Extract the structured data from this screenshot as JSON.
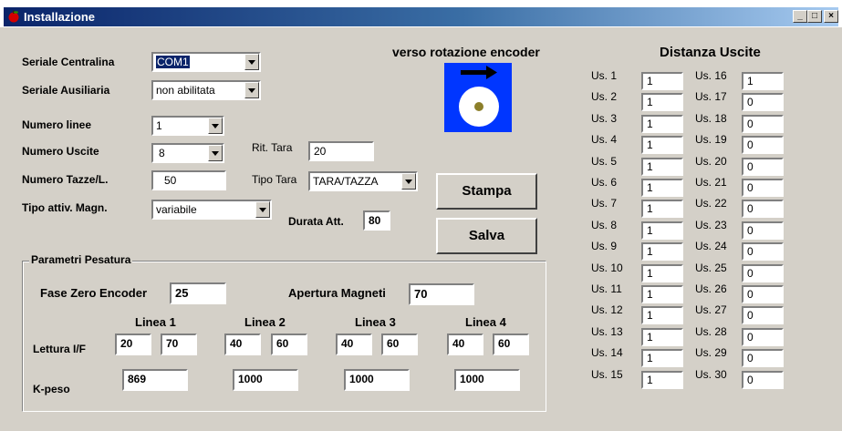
{
  "window": {
    "title": "Installazione",
    "min": "_",
    "max": "□",
    "close": "×"
  },
  "fields": {
    "seriale_centralina": {
      "label": "Seriale Centralina",
      "value": "COM1"
    },
    "seriale_ausiliaria": {
      "label": "Seriale Ausiliaria",
      "value": "non abilitata"
    },
    "numero_linee": {
      "label": "Numero linee",
      "value": "1"
    },
    "numero_uscite": {
      "label": "Numero Uscite",
      "value": "8"
    },
    "numero_tazze": {
      "label": "Numero Tazze/L.",
      "value": "50"
    },
    "tipo_attiv": {
      "label": "Tipo attiv. Magn.",
      "value": "variabile"
    },
    "rit_tara": {
      "label": "Rit. Tara",
      "value": "20"
    },
    "tipo_tara": {
      "label": "Tipo Tara",
      "value": "TARA/TAZZA"
    },
    "durata_att": {
      "label": "Durata Att.",
      "value": "80"
    }
  },
  "encoder": {
    "label": "verso rotazione encoder"
  },
  "buttons": {
    "stampa": "Stampa",
    "salva": "Salva"
  },
  "pesatura": {
    "title": "Parametri Pesatura",
    "fase_zero": {
      "label": "Fase Zero Encoder",
      "value": "25"
    },
    "apertura": {
      "label": "Apertura Magneti",
      "value": "70"
    },
    "lettura_label": "Lettura I/F",
    "kpeso_label": "K-peso",
    "lines": [
      {
        "name": "Linea 1",
        "lettura_a": "20",
        "lettura_b": "70",
        "kpeso": "869"
      },
      {
        "name": "Linea 2",
        "lettura_a": "40",
        "lettura_b": "60",
        "kpeso": "1000"
      },
      {
        "name": "Linea 3",
        "lettura_a": "40",
        "lettura_b": "60",
        "kpeso": "1000"
      },
      {
        "name": "Linea 4",
        "lettura_a": "40",
        "lettura_b": "60",
        "kpeso": "1000"
      }
    ]
  },
  "uscite": {
    "title": "Distanza Uscite",
    "left": [
      {
        "label": "Us. 1",
        "value": "1"
      },
      {
        "label": "Us. 2",
        "value": "1"
      },
      {
        "label": "Us. 3",
        "value": "1"
      },
      {
        "label": "Us. 4",
        "value": "1"
      },
      {
        "label": "Us. 5",
        "value": "1"
      },
      {
        "label": "Us. 6",
        "value": "1"
      },
      {
        "label": "Us. 7",
        "value": "1"
      },
      {
        "label": "Us. 8",
        "value": "1"
      },
      {
        "label": "Us. 9",
        "value": "1"
      },
      {
        "label": "Us. 10",
        "value": "1"
      },
      {
        "label": "Us. 11",
        "value": "1"
      },
      {
        "label": "Us. 12",
        "value": "1"
      },
      {
        "label": "Us. 13",
        "value": "1"
      },
      {
        "label": "Us. 14",
        "value": "1"
      },
      {
        "label": "Us. 15",
        "value": "1"
      }
    ],
    "right": [
      {
        "label": "Us. 16",
        "value": "1"
      },
      {
        "label": "Us. 17",
        "value": "0"
      },
      {
        "label": "Us. 18",
        "value": "0"
      },
      {
        "label": "Us. 19",
        "value": "0"
      },
      {
        "label": "Us. 20",
        "value": "0"
      },
      {
        "label": "Us. 21",
        "value": "0"
      },
      {
        "label": "Us. 22",
        "value": "0"
      },
      {
        "label": "Us. 23",
        "value": "0"
      },
      {
        "label": "Us. 24",
        "value": "0"
      },
      {
        "label": "Us. 25",
        "value": "0"
      },
      {
        "label": "Us. 26",
        "value": "0"
      },
      {
        "label": "Us. 27",
        "value": "0"
      },
      {
        "label": "Us. 28",
        "value": "0"
      },
      {
        "label": "Us. 29",
        "value": "0"
      },
      {
        "label": "Us. 30",
        "value": "0"
      }
    ]
  }
}
